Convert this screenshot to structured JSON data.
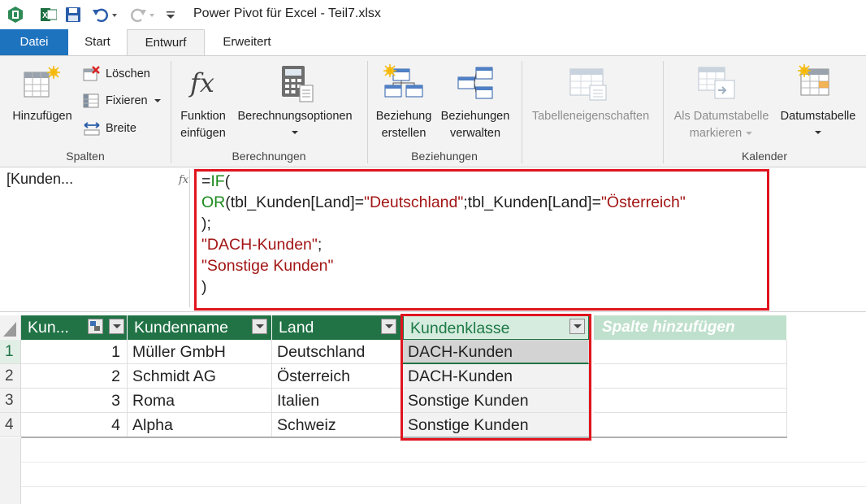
{
  "window": {
    "title": "Power Pivot für Excel - Teil7.xlsx"
  },
  "tabs": [
    {
      "label": "Datei"
    },
    {
      "label": "Start"
    },
    {
      "label": "Entwurf"
    },
    {
      "label": "Erweitert"
    }
  ],
  "ribbon": {
    "spalten": {
      "label": "Spalten",
      "hinzufuegen": "Hinzufügen",
      "loeschen": "Löschen",
      "fixieren": "Fixieren",
      "breite": "Breite"
    },
    "berechnungen": {
      "label": "Berechnungen",
      "funktion_line1": "Funktion",
      "funktion_line2": "einfügen",
      "optionen": "Berechnungsoptionen"
    },
    "beziehungen": {
      "label": "Beziehungen",
      "erstellen_line1": "Beziehung",
      "erstellen_line2": "erstellen",
      "verwalten_line1": "Beziehungen",
      "verwalten_line2": "verwalten"
    },
    "tabelle": {
      "eigenschaften": "Tabelleneigenschaften"
    },
    "kalender": {
      "label": "Kalender",
      "markieren_line1": "Als Datumstabelle",
      "markieren_line2": "markieren",
      "datumstabelle": "Datumstabelle"
    }
  },
  "formula_bar": {
    "name_box": "[Kunden...",
    "fx": "fx",
    "lines": {
      "l1_eq": "=",
      "l1_fn": "IF",
      "l1_paren": "(",
      "l2_fn": "OR",
      "l2_a": "(tbl_Kunden[Land]=",
      "l2_s1": "\"Deutschland\"",
      "l2_b": ";tbl_Kunden[Land]=",
      "l2_s2": "\"Österreich\"",
      "l3": ");",
      "l4_s": "\"DACH-Kunden\"",
      "l4_semi": ";",
      "l5_s": "\"Sonstige Kunden\"",
      "l6": ")"
    }
  },
  "table": {
    "headers": {
      "id": "Kun...",
      "name": "Kundenname",
      "land": "Land",
      "klasse": "Kundenklasse",
      "add": "Spalte hinzufügen"
    },
    "rows": [
      {
        "num": "1",
        "id": "1",
        "name": "Müller GmbH",
        "land": "Deutschland",
        "klasse": "DACH-Kunden"
      },
      {
        "num": "2",
        "id": "2",
        "name": "Schmidt AG",
        "land": "Österreich",
        "klasse": "DACH-Kunden"
      },
      {
        "num": "3",
        "id": "3",
        "name": "Roma",
        "land": "Italien",
        "klasse": "Sonstige Kunden"
      },
      {
        "num": "4",
        "id": "4",
        "name": "Alpha",
        "land": "Schweiz",
        "klasse": "Sonstige Kunden"
      }
    ]
  },
  "colors": {
    "accent_green": "#217346",
    "file_tab_blue": "#1e73be",
    "highlight_red": "#e0141e",
    "keyword_green": "#1a8a1a",
    "string_red": "#a31515"
  }
}
